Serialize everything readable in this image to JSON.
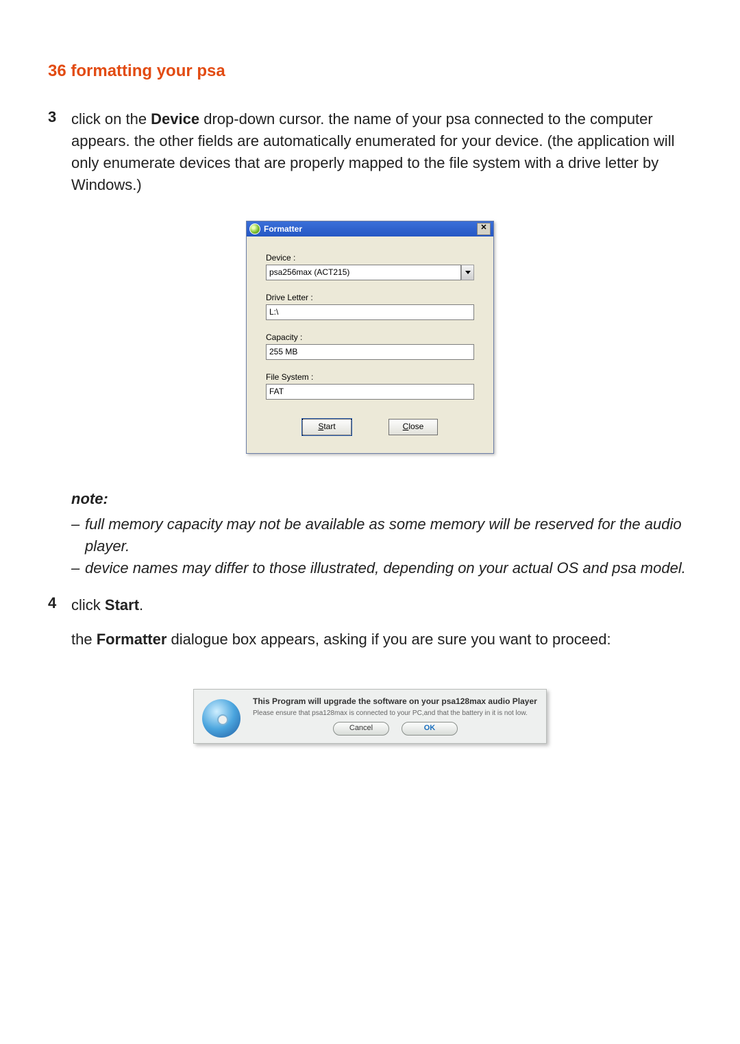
{
  "heading_prefix": "36 ",
  "heading": "formatting your psa",
  "step3": {
    "num": "3",
    "pre": "click on the ",
    "bold": "Device",
    "post": " drop-down cursor. the name of your psa connected to the computer appears. the other fields are automatically enumerated for your device. (the application will only enumerate devices that are properly mapped to the file system with a drive letter by Windows.)"
  },
  "formatter": {
    "title": "Formatter",
    "close_glyph": "✕",
    "device_label": "Device :",
    "device_value": "psa256max (ACT215)",
    "drive_label": "Drive Letter :",
    "drive_value": "L:\\",
    "capacity_label": "Capacity :",
    "capacity_value": "255 MB",
    "fs_label": "File System :",
    "fs_value": "FAT",
    "start_btn": "Start",
    "close_btn": "Close"
  },
  "note": {
    "title": "note",
    "colon": ":",
    "dash": "–",
    "n1": "full memory capacity may not be available as some memory will be reserved for the audio player.",
    "n2": "device names may differ to those illustrated, depending on your actual OS and psa model."
  },
  "step4": {
    "num": "4",
    "pre": "click ",
    "bold": "Start",
    "post": "."
  },
  "para": {
    "pre": "the ",
    "bold": "Formatter",
    "post": " dialogue box appears, asking if you are sure you want to proceed:"
  },
  "upgrade": {
    "title": "This Program will upgrade the software on your psa128max audio Player",
    "sub": "Please ensure that psa128max is connected to your PC,and that the battery in it is not low.",
    "cancel": "Cancel",
    "ok": "OK"
  }
}
